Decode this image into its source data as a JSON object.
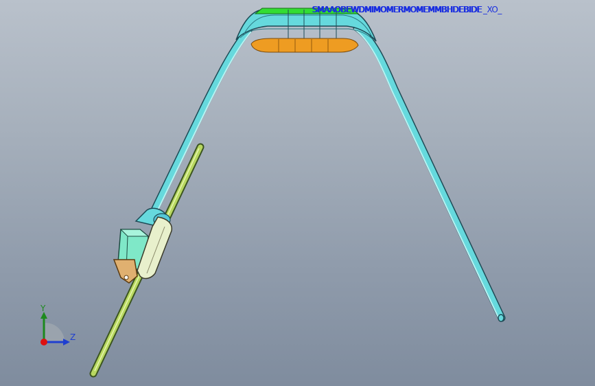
{
  "viewport": {
    "background_top": "#b9c1cb",
    "background_bottom": "#7f8c9e"
  },
  "overlay": {
    "label": "SMAAOBEWDMIMOMERMOMEMMBHDEBIDE",
    "suffix": "_XO_",
    "color": "#1a2fe0"
  },
  "model": {
    "band_color": "#66d9dd",
    "top_face_color": "#33dd33",
    "bottom_pad_color": "#ee9c22",
    "body_color": "#66d9dd",
    "box_color": "#7fe8c8",
    "case_color": "#e8f0cc",
    "rod_color": "#b8d860",
    "bracket_color": "#e0b070"
  },
  "triad": {
    "y_label": "Y",
    "z_label": "Z",
    "y_color": "#1e8a1e",
    "z_color": "#1f3fd0",
    "x_color": "#dd1111"
  }
}
